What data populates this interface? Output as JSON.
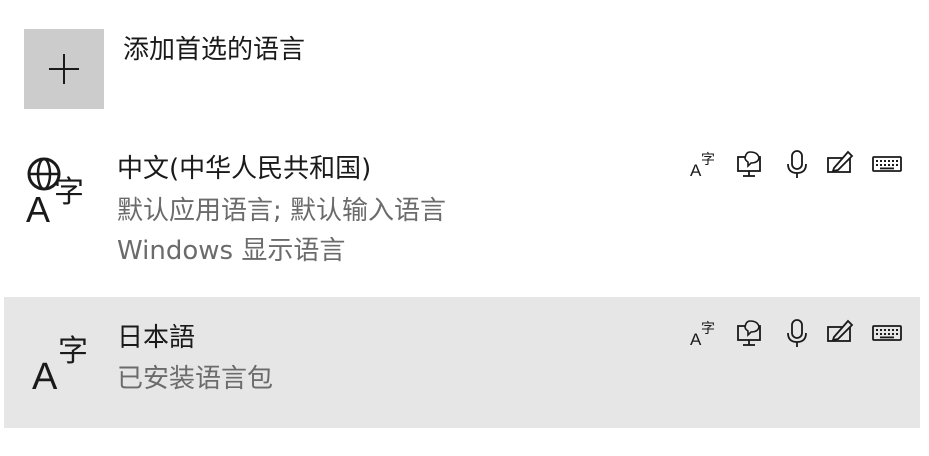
{
  "add_language": {
    "label": "添加首选的语言"
  },
  "languages": [
    {
      "name": "中文(中华人民共和国)",
      "subtitle_line1": "默认应用语言; 默认输入语言",
      "subtitle_line2": "Windows 显示语言",
      "icon": "globe-language-icon",
      "features": [
        "text-to-speech-icon",
        "speech-recognition-icon",
        "microphone-icon",
        "handwriting-icon",
        "keyboard-icon"
      ]
    },
    {
      "name": "日本語",
      "subtitle_line1": "已安装语言包",
      "icon": "language-icon",
      "features": [
        "text-to-speech-icon",
        "speech-recognition-icon",
        "microphone-icon",
        "handwriting-icon",
        "keyboard-icon"
      ],
      "selected": true
    }
  ],
  "colors": {
    "add_button_bg": "#cccccc",
    "selected_row_bg": "#e6e6e6",
    "primary_text": "#1a1a1a",
    "secondary_text": "#6b6b6b"
  }
}
